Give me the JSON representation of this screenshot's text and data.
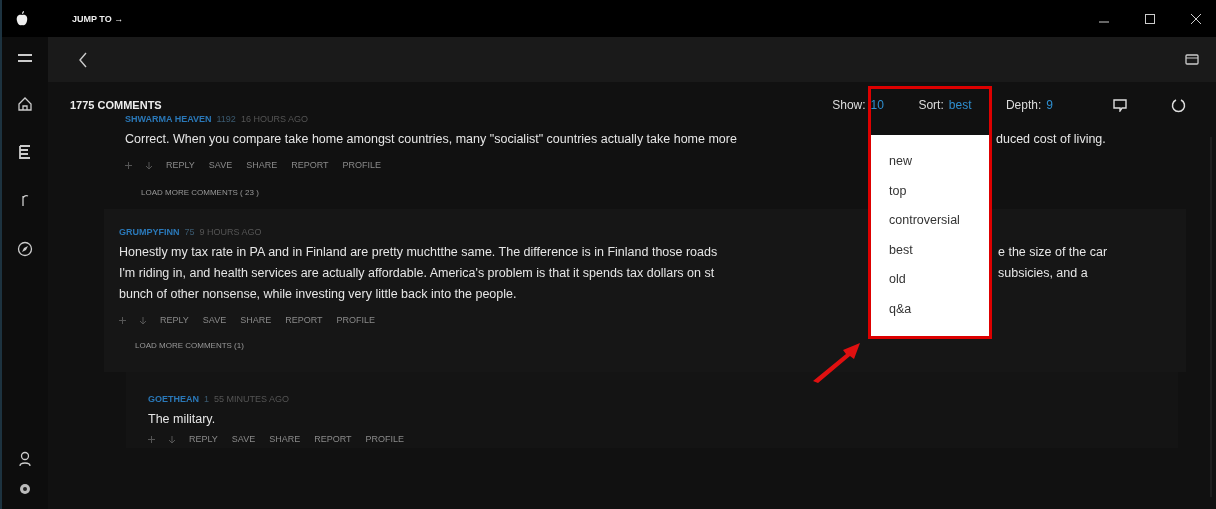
{
  "title_bar": {
    "jump_to": "JUMP TO →"
  },
  "header": {
    "count": "1775 COMMENTS",
    "show_label": "Show:",
    "show_value": "10",
    "sort_label": "Sort:",
    "sort_value": "best",
    "depth_label": "Depth:",
    "depth_value": "9"
  },
  "sort_menu": {
    "options": [
      "new",
      "top",
      "controversial",
      "best",
      "old",
      "q&a"
    ]
  },
  "comments": [
    {
      "author": "SHWARMA HEAVEN",
      "score": "1192",
      "age": "16 HOURS AGO",
      "lines": [
        [
          "Correct. When you compare take home amongst countries, many \"socialist\" countries actually take home more",
          "duced cost of living."
        ]
      ],
      "actions": [
        "REPLY",
        "SAVE",
        "SHARE",
        "REPORT",
        "PROFILE"
      ],
      "load_more": "LOAD MORE COMMENTS ( 23 )"
    },
    {
      "author": "GRUMPYFINN",
      "score": "75",
      "age": "9 HOURS AGO",
      "lines": [
        [
          "Honestly my tax rate in PA and in Finland are pretty muchtthe same. The difference is in Finland those roads",
          "e the size of the car"
        ],
        [
          "I'm riding in, and health services are actually affordable.  America's problem is that it spends tax dollars on st",
          "subsicies, and a"
        ],
        [
          "bunch of other nonsense, while investing very little back into the people."
        ]
      ],
      "actions": [
        "REPLY",
        "SAVE",
        "SHARE",
        "REPORT",
        "PROFILE"
      ],
      "load_more": "LOAD MORE COMMENTS (1)"
    },
    {
      "author": "GOETHEAN",
      "score": "1",
      "age": "55 MINUTES AGO",
      "lines": [
        [
          "The military."
        ]
      ],
      "actions": [
        "REPLY",
        "SAVE",
        "SHARE",
        "REPORT",
        "PROFILE"
      ]
    }
  ]
}
